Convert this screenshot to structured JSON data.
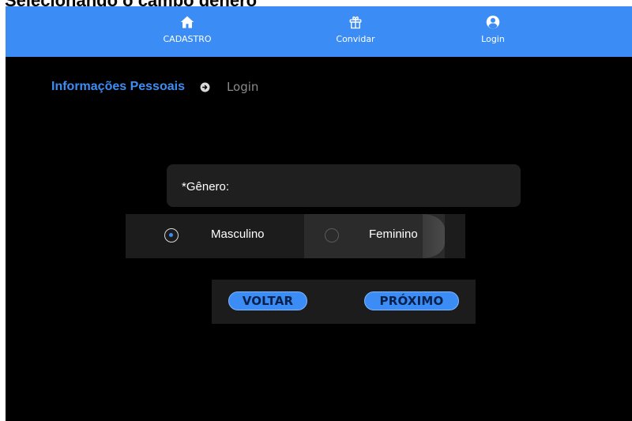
{
  "caption": "Selecionando o campo gênero",
  "navbar": {
    "items": [
      {
        "label": "CADASTRO",
        "icon": "home-icon"
      },
      {
        "label": "Convidar",
        "icon": "gift-icon"
      },
      {
        "label": "Login",
        "icon": "user-circle-icon"
      }
    ]
  },
  "steps": {
    "active": "Informações Pessoais",
    "inactive": "Login",
    "arrow_icon": "arrow-right-circle-icon"
  },
  "form": {
    "gender_label": "*Gênero:",
    "options": [
      {
        "label": "Masculino",
        "selected": true
      },
      {
        "label": "Feminino",
        "selected": false
      }
    ]
  },
  "buttons": {
    "back": "VOLTAR",
    "next": "PRÓXIMO"
  },
  "colors": {
    "accent": "#3c8cf6",
    "background": "#000000",
    "panel": "#1c1c1c"
  }
}
